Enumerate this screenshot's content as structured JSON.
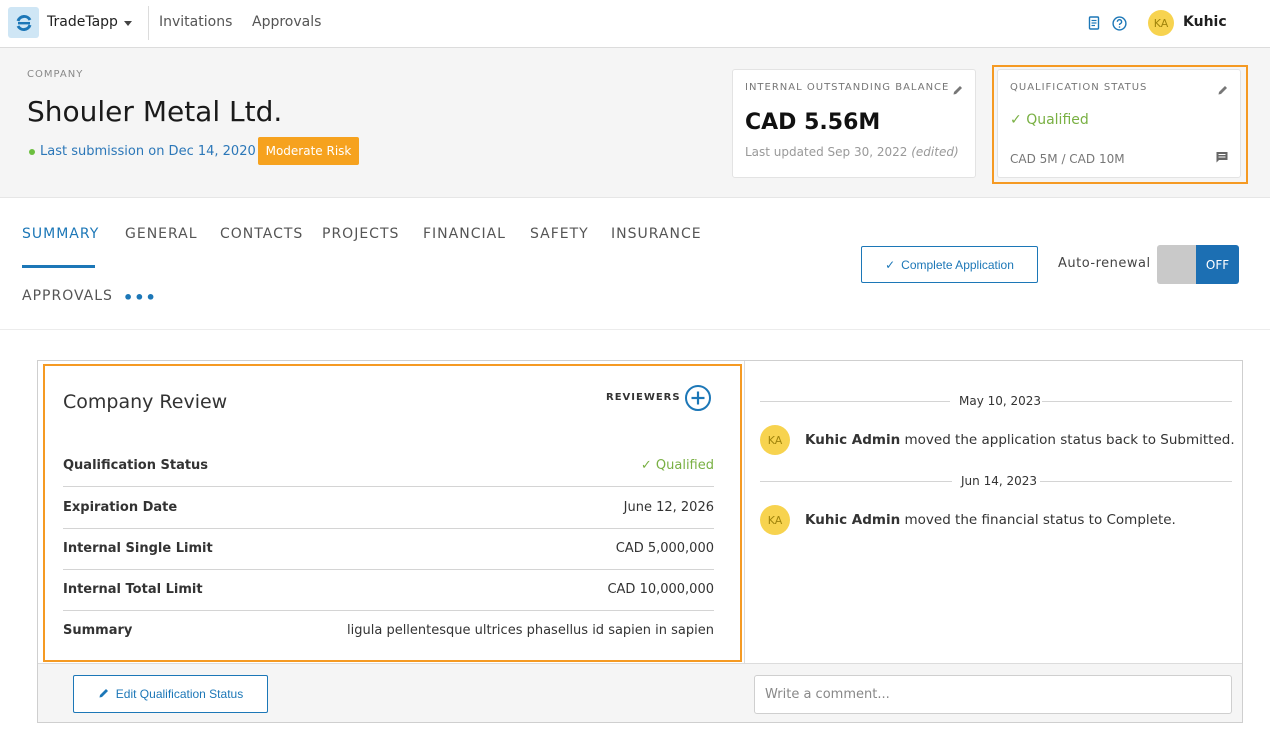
{
  "topnav": {
    "app_name": "TradeTapp",
    "links": [
      "Invitations",
      "Approvals"
    ],
    "user_initials": "KA",
    "user_name": "Kuhic"
  },
  "header": {
    "company_label": "COMPANY",
    "company_name": "Shouler Metal Ltd.",
    "last_submission": "Last submission on Dec 14, 2020",
    "risk_badge": "Moderate Risk",
    "balance_card": {
      "label": "INTERNAL OUTSTANDING BALANCE",
      "value": "CAD 5.56M",
      "updated": "Last updated Sep 30, 2022",
      "edited": "(edited)"
    },
    "qualification_card": {
      "label": "QUALIFICATION STATUS",
      "status": "Qualified",
      "range": "CAD 5M / CAD 10M"
    }
  },
  "tabs": {
    "items": [
      "SUMMARY",
      "GENERAL",
      "CONTACTS",
      "PROJECTS",
      "FINANCIAL",
      "SAFETY",
      "INSURANCE",
      "APPROVALS"
    ],
    "more": "•••",
    "complete_application": "Complete Application",
    "auto_renewal_label": "Auto-renewal",
    "auto_renewal_state": "OFF"
  },
  "review": {
    "title": "Company Review",
    "reviewers_label": "REVIEWERS",
    "rows": [
      {
        "label": "Qualification Status",
        "value": "Qualified"
      },
      {
        "label": "Expiration Date",
        "value": "June 12, 2026"
      },
      {
        "label": "Internal Single Limit",
        "value": "CAD 5,000,000"
      },
      {
        "label": "Internal Total Limit",
        "value": "CAD 10,000,000"
      },
      {
        "label": "Summary",
        "value": "ligula pellentesque ultrices phasellus id sapien in sapien"
      }
    ],
    "edit_button": "Edit Qualification Status"
  },
  "activity": {
    "entries": [
      {
        "date": "May 10, 2023",
        "initials": "KA",
        "actor": "Kuhic Admin",
        "text": " moved the application status back to Submitted."
      },
      {
        "date": "Jun 14, 2023",
        "initials": "KA",
        "actor": "Kuhic Admin",
        "text": " moved the financial status to Complete."
      }
    ],
    "comment_placeholder": "Write a comment..."
  },
  "colors": {
    "accent": "#1c77b7",
    "qualified": "#79b043",
    "risk": "#f6a21e",
    "highlight": "#f59a23"
  }
}
